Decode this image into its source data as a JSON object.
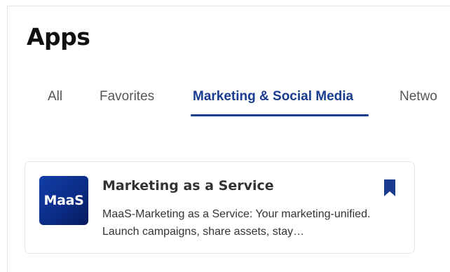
{
  "page": {
    "title": "Apps"
  },
  "tabs": [
    {
      "label": "All",
      "active": false
    },
    {
      "label": "Favorites",
      "active": false
    },
    {
      "label": "Marketing & Social Media",
      "active": true
    },
    {
      "label": "Netwo",
      "active": false
    }
  ],
  "app_card": {
    "logo_text": "MaaS",
    "title": "Marketing as a Service",
    "description": "MaaS-Marketing as a Service: Your marketing-unified. Launch campaigns, share assets, stay…",
    "bookmark_icon": "bookmark-icon",
    "bookmarked": true
  },
  "colors": {
    "accent": "#1a3c8f",
    "logo_gradient_start": "#123fa8",
    "logo_gradient_end": "#06195c",
    "text_primary": "#333333",
    "tab_inactive": "#555555"
  }
}
